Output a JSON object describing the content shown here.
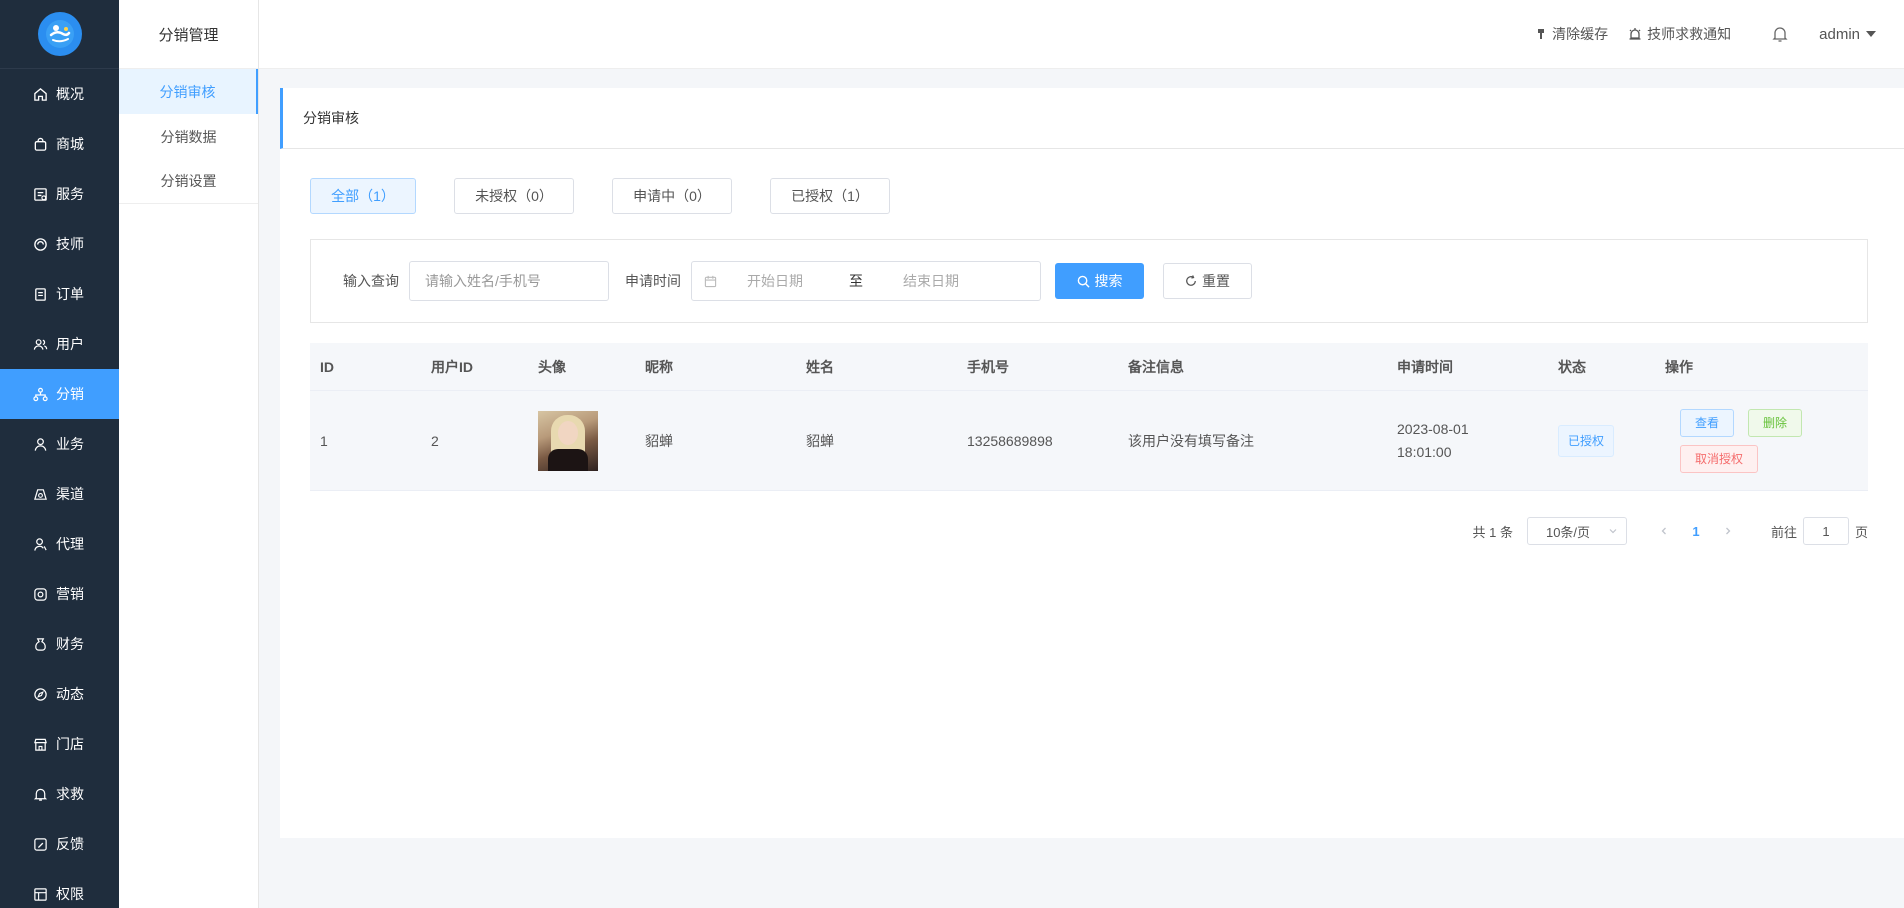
{
  "sidebar": {
    "items": [
      {
        "label": "概况",
        "icon": "home-icon"
      },
      {
        "label": "商城",
        "icon": "shop-bag-icon"
      },
      {
        "label": "服务",
        "icon": "service-icon"
      },
      {
        "label": "技师",
        "icon": "technician-icon"
      },
      {
        "label": "订单",
        "icon": "order-icon"
      },
      {
        "label": "用户",
        "icon": "users-icon"
      },
      {
        "label": "分销",
        "icon": "distribution-icon",
        "active": true
      },
      {
        "label": "业务",
        "icon": "business-icon"
      },
      {
        "label": "渠道",
        "icon": "channel-icon"
      },
      {
        "label": "代理",
        "icon": "agent-icon"
      },
      {
        "label": "营销",
        "icon": "marketing-icon"
      },
      {
        "label": "财务",
        "icon": "finance-icon"
      },
      {
        "label": "动态",
        "icon": "compass-icon"
      },
      {
        "label": "门店",
        "icon": "store-icon"
      },
      {
        "label": "求救",
        "icon": "bell-icon"
      },
      {
        "label": "反馈",
        "icon": "feedback-icon"
      },
      {
        "label": "权限",
        "icon": "permission-icon"
      }
    ]
  },
  "submenu": {
    "title": "分销管理",
    "items": [
      "分销审核",
      "分销数据",
      "分销设置"
    ]
  },
  "header": {
    "clear_cache": "清除缓存",
    "sos_notice": "技师求救通知",
    "user": "admin"
  },
  "card": {
    "title": "分销审核",
    "tabs": [
      "全部（1）",
      "未授权（0）",
      "申请中（0）",
      "已授权（1）"
    ],
    "filter": {
      "query_label": "输入查询",
      "query_placeholder": "请输入姓名/手机号",
      "time_label": "申请时间",
      "start_placeholder": "开始日期",
      "range_sep": "至",
      "end_placeholder": "结束日期",
      "search_btn": "搜索",
      "reset_btn": "重置"
    },
    "table": {
      "headers": [
        "ID",
        "用户ID",
        "头像",
        "昵称",
        "姓名",
        "手机号",
        "备注信息",
        "申请时间",
        "状态",
        "操作"
      ],
      "rows": [
        {
          "id": "1",
          "user_id": "2",
          "nickname": "貂蝉",
          "name": "貂蝉",
          "phone": "13258689898",
          "remark": "该用户没有填写备注",
          "time_date": "2023-08-01",
          "time_clock": "18:01:00",
          "status": "已授权",
          "ops": {
            "view": "查看",
            "delete": "删除",
            "revoke": "取消授权"
          }
        }
      ]
    },
    "pagination": {
      "total": "共 1 条",
      "page_size": "10条/页",
      "current": "1",
      "goto_label": "前往",
      "goto_value": "1",
      "page_unit": "页"
    }
  },
  "colors": {
    "sidebar_bg": "#1f2d3d",
    "accent": "#409eff",
    "success": "#67c23a",
    "danger": "#f56c6c"
  }
}
